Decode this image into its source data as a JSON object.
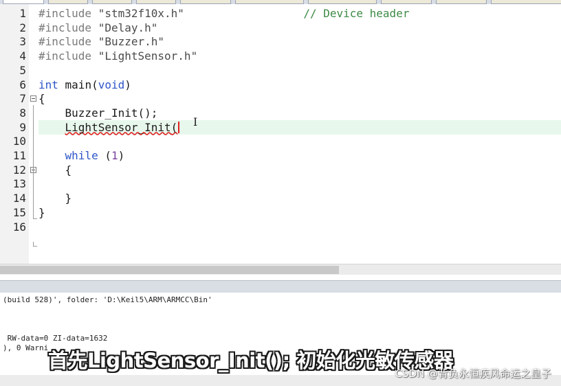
{
  "editor": {
    "lines": [
      {
        "n": "1",
        "tokens": [
          {
            "t": "#include ",
            "c": "pp"
          },
          {
            "t": "\"stm32f10x.h\"",
            "c": "str"
          },
          {
            "t": "                  ",
            "c": ""
          },
          {
            "t": "// Device header",
            "c": "cmt"
          }
        ]
      },
      {
        "n": "2",
        "tokens": [
          {
            "t": "#include ",
            "c": "pp"
          },
          {
            "t": "\"Delay.h\"",
            "c": "str"
          }
        ]
      },
      {
        "n": "3",
        "tokens": [
          {
            "t": "#include ",
            "c": "pp"
          },
          {
            "t": "\"Buzzer.h\"",
            "c": "str"
          }
        ]
      },
      {
        "n": "4",
        "tokens": [
          {
            "t": "#include ",
            "c": "pp"
          },
          {
            "t": "\"LightSensor.h\"",
            "c": "str"
          }
        ]
      },
      {
        "n": "5",
        "tokens": []
      },
      {
        "n": "6",
        "tokens": [
          {
            "t": "int",
            "c": "kw"
          },
          {
            "t": " main(",
            "c": ""
          },
          {
            "t": "void",
            "c": "kw"
          },
          {
            "t": ")",
            "c": ""
          }
        ]
      },
      {
        "n": "7",
        "tokens": [
          {
            "t": "{",
            "c": ""
          }
        ]
      },
      {
        "n": "8",
        "tokens": [
          {
            "t": "    Buzzer_Init();",
            "c": ""
          }
        ]
      },
      {
        "n": "9",
        "tokens": [
          {
            "t": "    ",
            "c": ""
          },
          {
            "t": "LightSensor_Init",
            "c": "err"
          },
          {
            "t": "(",
            "c": "err"
          }
        ]
      },
      {
        "n": "10",
        "tokens": []
      },
      {
        "n": "11",
        "tokens": [
          {
            "t": "    ",
            "c": ""
          },
          {
            "t": "while",
            "c": "kw"
          },
          {
            "t": " (",
            "c": ""
          },
          {
            "t": "1",
            "c": "num"
          },
          {
            "t": ")",
            "c": ""
          }
        ]
      },
      {
        "n": "12",
        "tokens": [
          {
            "t": "    {",
            "c": ""
          }
        ]
      },
      {
        "n": "13",
        "tokens": []
      },
      {
        "n": "14",
        "tokens": [
          {
            "t": "    }",
            "c": ""
          }
        ]
      },
      {
        "n": "15",
        "tokens": [
          {
            "t": "}",
            "c": ""
          }
        ]
      },
      {
        "n": "16",
        "tokens": []
      }
    ],
    "current_line": "9",
    "fold_markers": [
      "7",
      "12"
    ]
  },
  "build_output": {
    "lines": [
      "(build 528)', folder: 'D:\\Keil5\\ARM\\ARMCC\\Bin'",
      "",
      "",
      "",
      " RW-data=0 ZI-data=1632",
      "), 0 Warni"
    ]
  },
  "overlay": {
    "subtitle": "首先LightSensor_Init(); 初始化光敏传感器",
    "watermark": "CSDN @背负永恒疾风命运之皇子"
  },
  "colors": {
    "keyword": "#2d55c8",
    "comment": "#3c8a45",
    "preprocessor": "#7a7a7a",
    "current_line": "#e8f7ec",
    "error_underline": "#e02020"
  }
}
